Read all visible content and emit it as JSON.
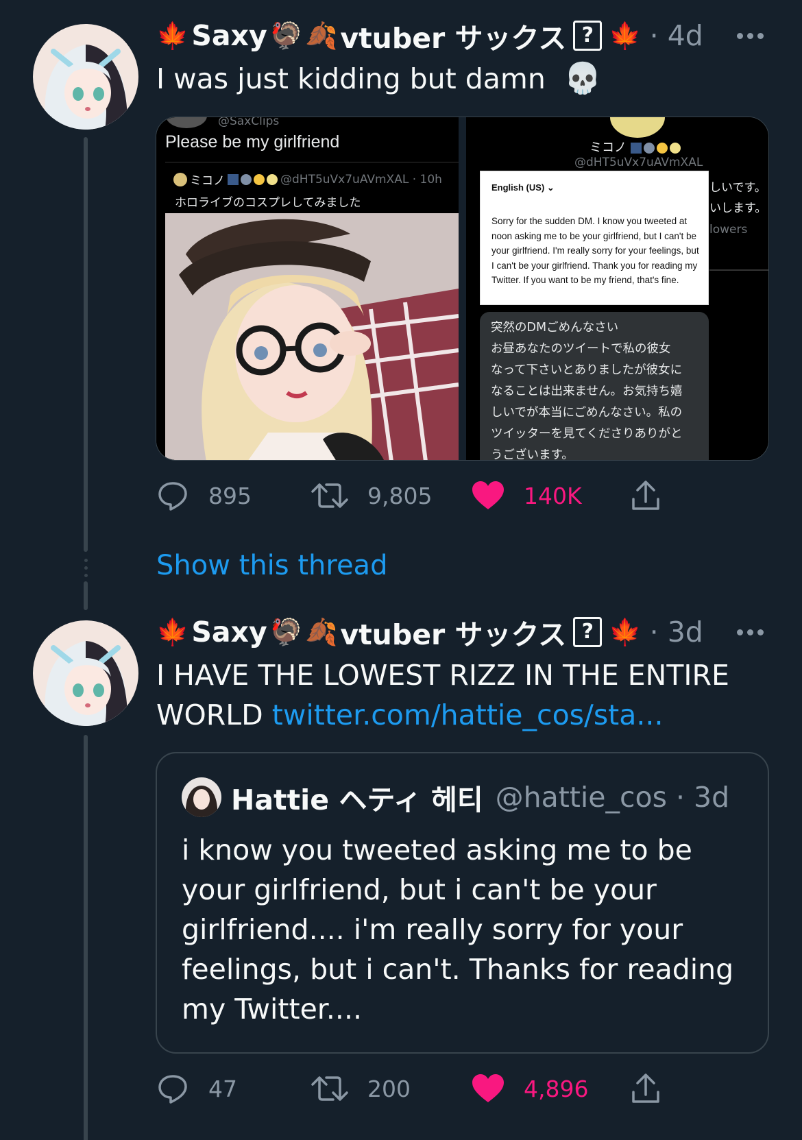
{
  "tweets": [
    {
      "author": {
        "name_prefix": "Saxy",
        "name_suffix": "vtuber サックス",
        "emoji_leaf": "🍁",
        "emoji_turkey": "🦃",
        "emoji_fallen": "🍂",
        "unknown_glyph": "?",
        "age": "· 4d"
      },
      "text": "I was just kidding but damn",
      "text_emoji": "💀",
      "media": {
        "left": {
          "handle": "@SaxClips",
          "text": "Please be my girlfriend",
          "quote_name": "ミコノ",
          "quote_handle": "@dHT5uVx7uAVmXAL · 10h",
          "quote_text": "ホロライブのコスプレしてみました"
        },
        "right": {
          "name": "ミコノ",
          "handle": "@dHT5uVx7uAVmXAL",
          "side_lines": [
            "しいです。",
            "いします。 旨",
            "lowers"
          ],
          "translate_lang": "English (US)",
          "translate_body": "Sorry for the sudden DM. I know you tweeted at noon asking me to be your girlfriend, but I can't be your girlfriend. I'm really sorry for your feelings, but I can't be your girlfriend. Thank you for reading my Twitter. If you want to be my friend, that's fine.",
          "jp_lines": [
            "突然のDMごめんなさい",
            "お昼あなたのツイートで私の彼女",
            "なって下さいとありましたが彼女に",
            "なることは出来ません。お気持ち嬉",
            "しいでが本当にごめんなさい。私の",
            "ツイッターを見てくださりありがと",
            "うございます。"
          ]
        }
      },
      "actions": {
        "replies": "895",
        "retweets": "9,805",
        "likes": "140K"
      }
    },
    {
      "author": {
        "name_prefix": "Saxy",
        "name_suffix": "vtuber サックス",
        "emoji_leaf": "🍁",
        "emoji_turkey": "🦃",
        "emoji_fallen": "🍂",
        "unknown_glyph": "?",
        "age": "· 3d"
      },
      "text_line1": "I HAVE THE LOWEST RIZZ IN THE ENTIRE",
      "text_line2": "WORLD",
      "link": "twitter.com/hattie_cos/sta...",
      "quote": {
        "name": "Hattie ヘティ 헤티",
        "handle": "@hattie_cos · 3d",
        "text": "i know you tweeted asking me to be your girlfriend, but i can't be your girlfriend.... i'm really sorry for your feelings, but i can't. Thanks for reading my Twitter...."
      },
      "actions": {
        "replies": "47",
        "retweets": "200",
        "likes": "4,896"
      }
    }
  ],
  "show_thread": "Show this thread",
  "colors": {
    "background": "#15202b",
    "accent": "#1d9bf0",
    "like": "#f91880",
    "muted": "#8b98a5"
  }
}
